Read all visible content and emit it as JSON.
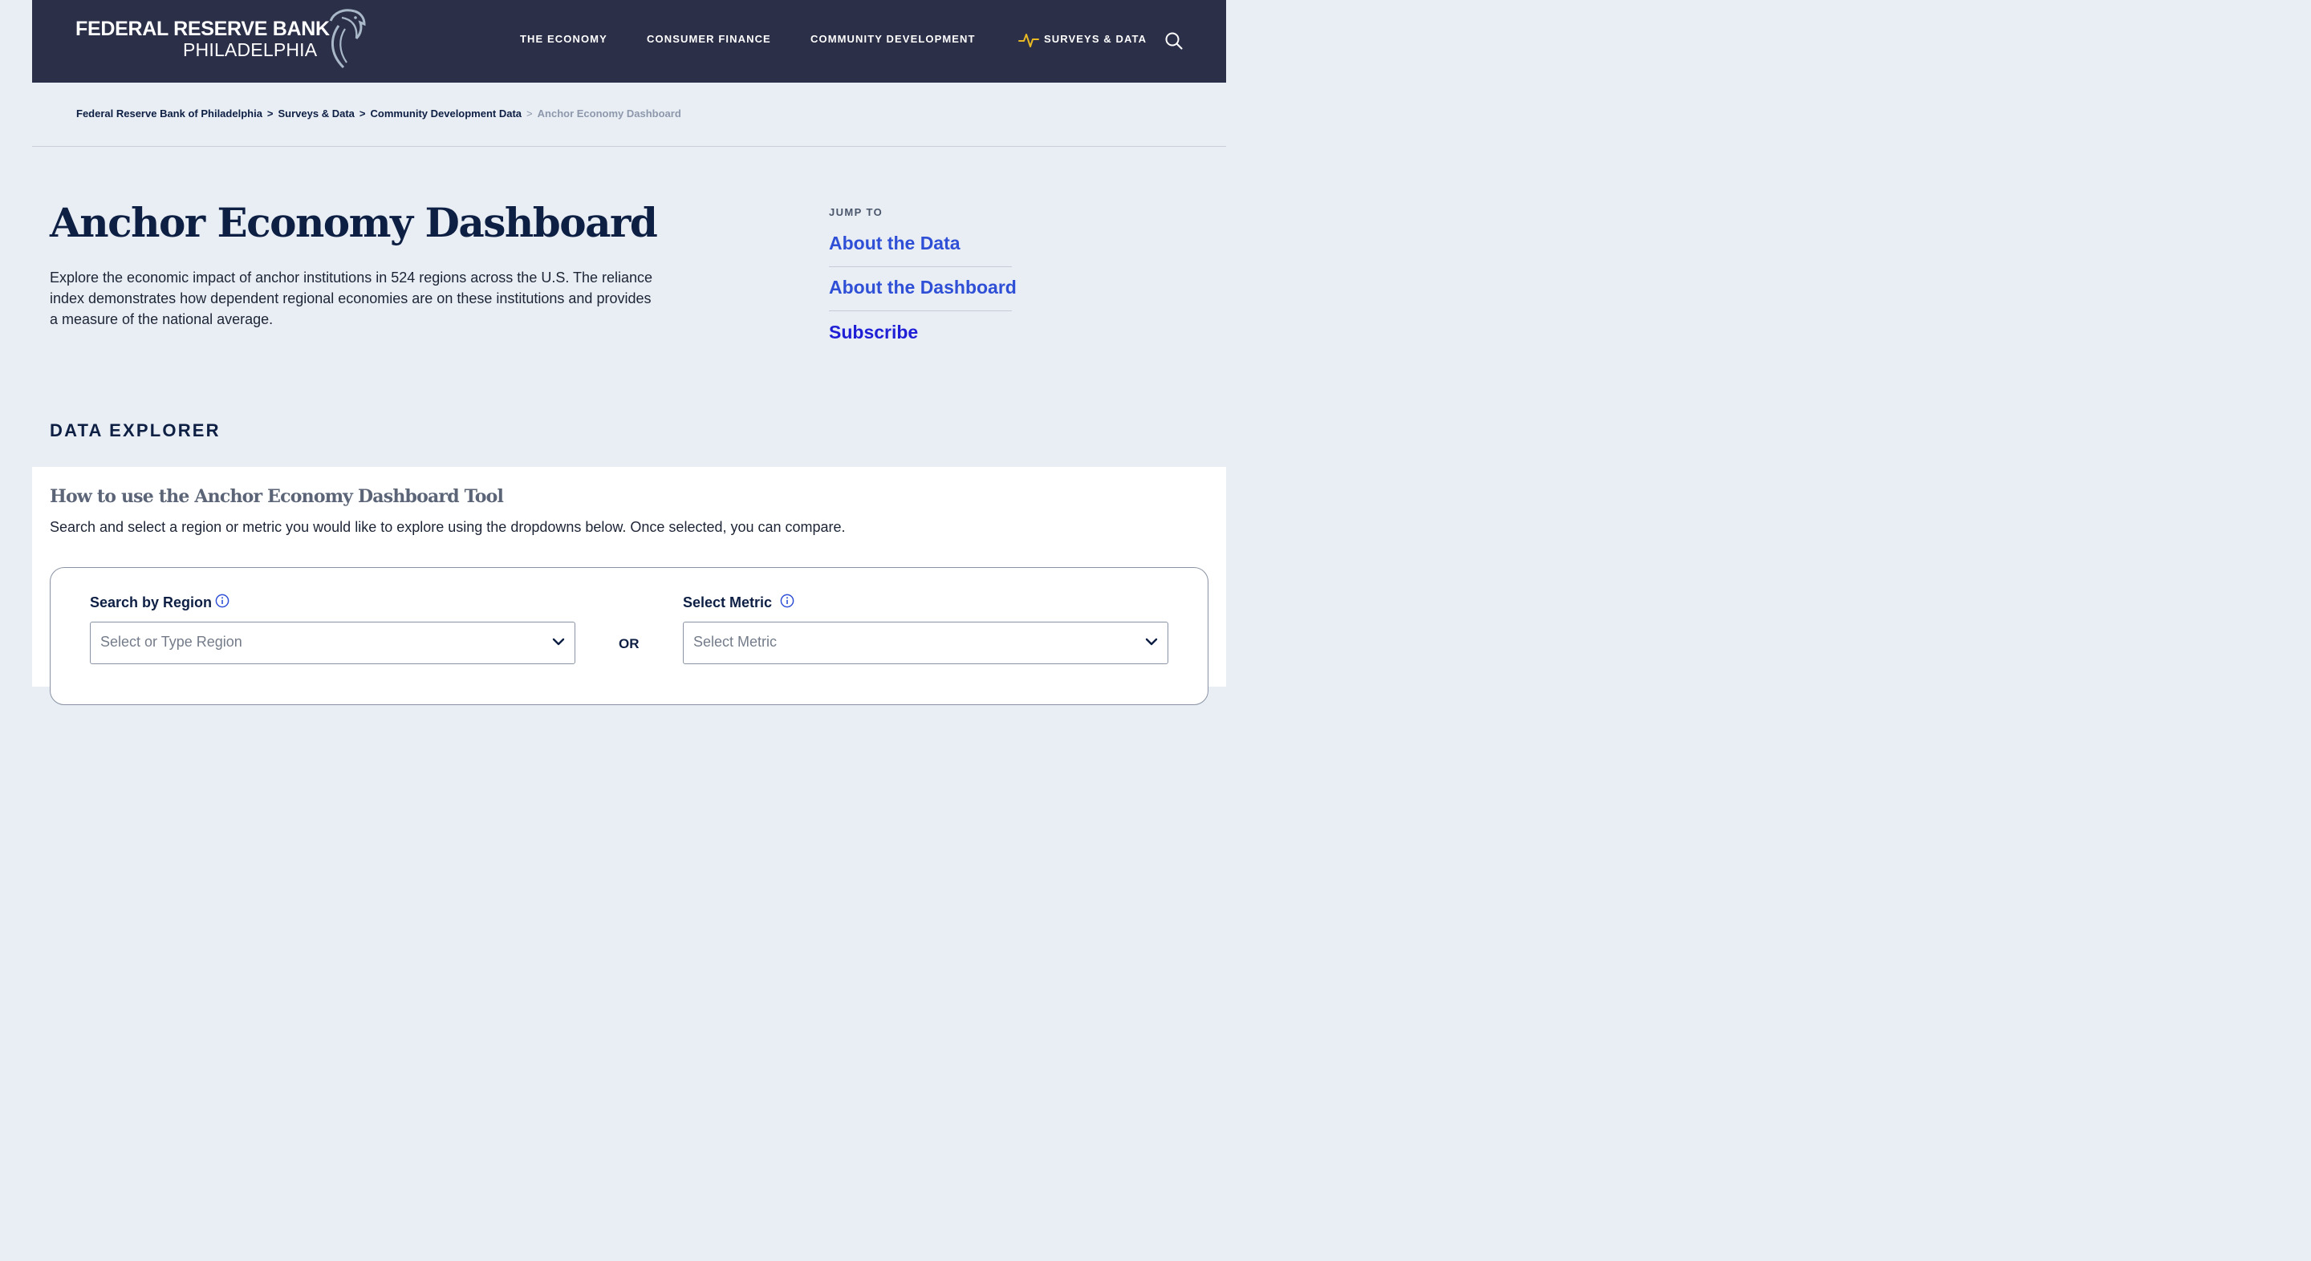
{
  "header": {
    "logo_line1": "FEDERAL RESERVE BANK",
    "logo_line2": "PHILADELPHIA",
    "nav": [
      {
        "label": "THE ECONOMY"
      },
      {
        "label": "CONSUMER FINANCE"
      },
      {
        "label": "COMMUNITY DEVELOPMENT"
      },
      {
        "label": "SURVEYS & DATA"
      }
    ],
    "colors": {
      "background": "#2b2f48",
      "accent": "#e8b923"
    }
  },
  "breadcrumb": {
    "items": [
      {
        "label": "Federal Reserve Bank of Philadelphia"
      },
      {
        "label": "Surveys & Data"
      },
      {
        "label": "Community Development Data"
      }
    ],
    "current": "Anchor Economy Dashboard",
    "separator": ">"
  },
  "main": {
    "title": "Anchor Economy Dashboard",
    "intro": "Explore the economic impact of anchor institutions in 524 regions across the U.S. The reliance index demonstrates how dependent regional economies are on these institutions and provides a measure of the national average."
  },
  "jump_to": {
    "label": "JUMP TO",
    "links": [
      {
        "label": "About the Data"
      },
      {
        "label": "About the Dashboard"
      },
      {
        "label": "Subscribe"
      }
    ]
  },
  "explorer": {
    "heading": "DATA EXPLORER",
    "howto_title": "How to use the Anchor Economy Dashboard Tool",
    "howto_desc": "Search and select a region or metric you would like to explore using the dropdowns below. Once selected, you can compare.",
    "region": {
      "label": "Search by Region",
      "placeholder": "Select or Type Region"
    },
    "or_label": "OR",
    "metric": {
      "label": "Select Metric",
      "placeholder": "Select Metric"
    }
  }
}
